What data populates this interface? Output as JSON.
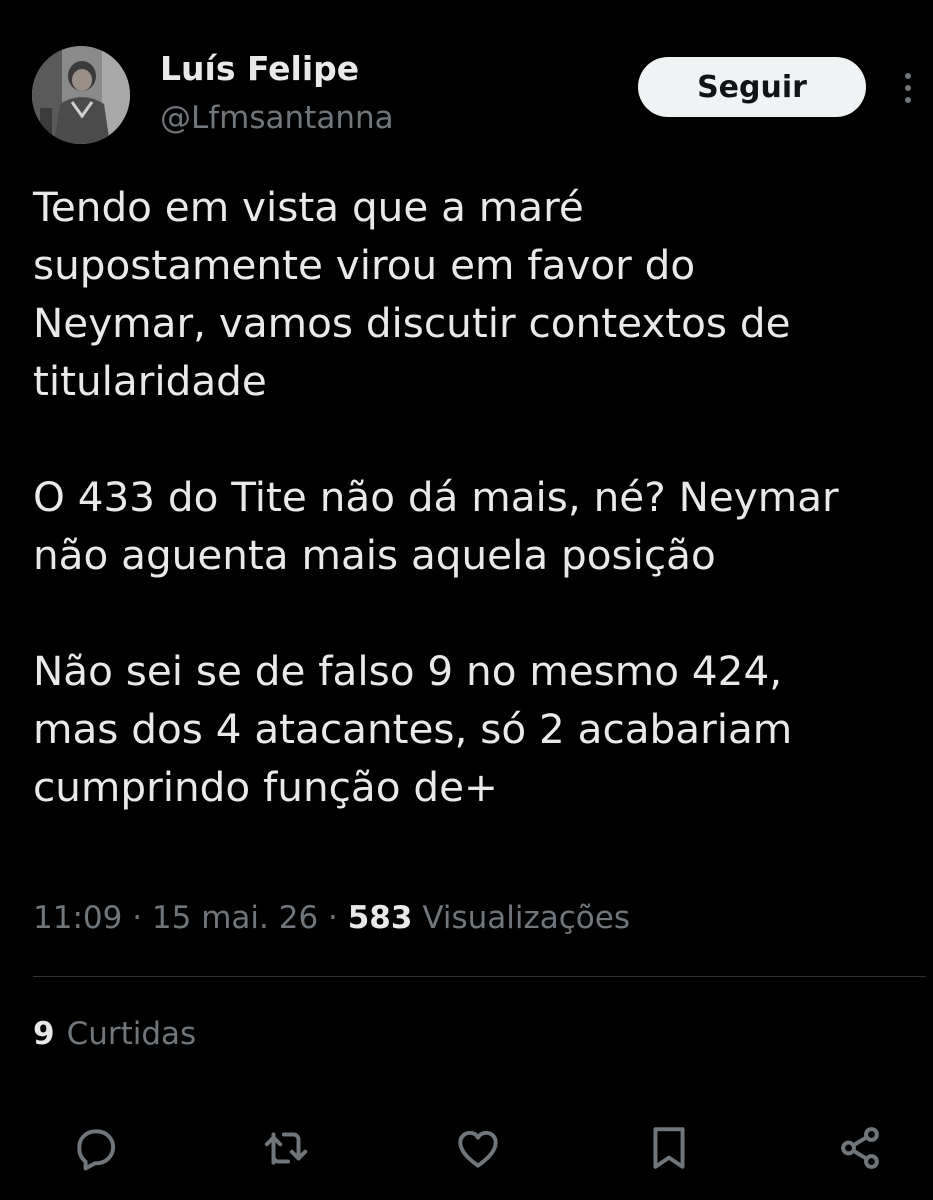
{
  "author": {
    "display_name": "Luís Felipe",
    "handle": "@Lfmsantanna"
  },
  "follow_button": {
    "label": "Seguir"
  },
  "tweet": {
    "paragraphs": [
      "Tendo em vista que a maré\nsupostamente virou em favor do\nNeymar, vamos discutir contextos de\ntitularidade",
      "O 433 do Tite não dá mais, né? Neymar\nnão aguenta mais aquela posição",
      "Não sei se de falso 9 no mesmo 424,\nmas dos 4 atacantes, só 2 acabariam\ncumprindo função de+"
    ]
  },
  "meta": {
    "time": "11:09",
    "separator": " · ",
    "date": "15 mai. 26",
    "views_count": "583",
    "views_label": "Visualizações"
  },
  "engagement": {
    "likes_count": "9",
    "likes_label": "Curtidas"
  },
  "actions": [
    "reply-icon",
    "retweet-icon",
    "like-icon",
    "bookmark-icon",
    "share-icon"
  ],
  "colors": {
    "background": "#000000",
    "text_primary": "#e7e9ea",
    "text_secondary": "#71767b",
    "button_bg": "#eff3f4",
    "divider": "#2f3336"
  }
}
